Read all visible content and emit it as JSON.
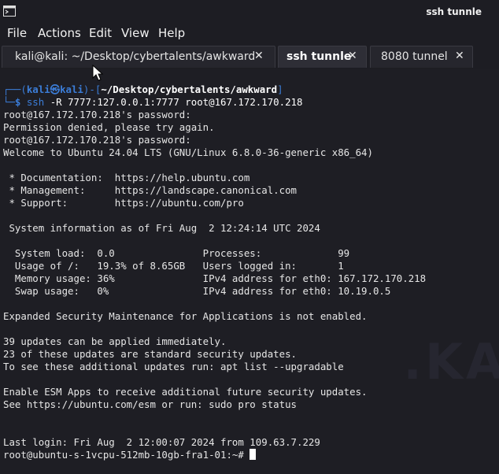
{
  "window": {
    "title": "ssh tunnle"
  },
  "menu": {
    "items": [
      "File",
      "Actions",
      "Edit",
      "View",
      "Help"
    ]
  },
  "tabs": [
    {
      "label": "kali@kali: ~/Desktop/cybertalents/awkward",
      "active": false
    },
    {
      "label": "ssh tunnle",
      "active": true
    },
    {
      "label": "8080 tunnel",
      "active": false
    }
  ],
  "tab_close_glyph": "✕",
  "terminal": {
    "prompt": {
      "corner_top": "┌──(",
      "user": "kali㉿kali",
      "mid": ")-[",
      "path": "~/Desktop/cybertalents/awkward",
      "end": "]",
      "corner_bottom": "└─",
      "symbol": "$ ",
      "command": "ssh",
      "args": " -R 7777:127.0.0.1:7777 root@167.172.170.218"
    },
    "lines": [
      "root@167.172.170.218's password:",
      "Permission denied, please try again.",
      "root@167.172.170.218's password:",
      "Welcome to Ubuntu 24.04 LTS (GNU/Linux 6.8.0-36-generic x86_64)",
      "",
      " * Documentation:  https://help.ubuntu.com",
      " * Management:     https://landscape.canonical.com",
      " * Support:        https://ubuntu.com/pro",
      "",
      " System information as of Fri Aug  2 12:24:14 UTC 2024",
      "",
      "  System load:  0.0               Processes:             99",
      "  Usage of /:   19.3% of 8.65GB   Users logged in:       1",
      "  Memory usage: 36%               IPv4 address for eth0: 167.172.170.218",
      "  Swap usage:   0%                IPv4 address for eth0: 10.19.0.5",
      "",
      "Expanded Security Maintenance for Applications is not enabled.",
      "",
      "39 updates can be applied immediately.",
      "23 of these updates are standard security updates.",
      "To see these additional updates run: apt list --upgradable",
      "",
      "Enable ESM Apps to receive additional future security updates.",
      "See https://ubuntu.com/esm or run: sudo pro status",
      "",
      "",
      "Last login: Fri Aug  2 12:00:07 2024 from 109.63.7.229"
    ],
    "final_prompt": "root@ubuntu-s-1vcpu-512mb-10gb-fra1-01:~# "
  },
  "colors": {
    "prompt_blue": "#3b7dd8",
    "background": "#1e1e24",
    "text": "#e6e6e6"
  }
}
